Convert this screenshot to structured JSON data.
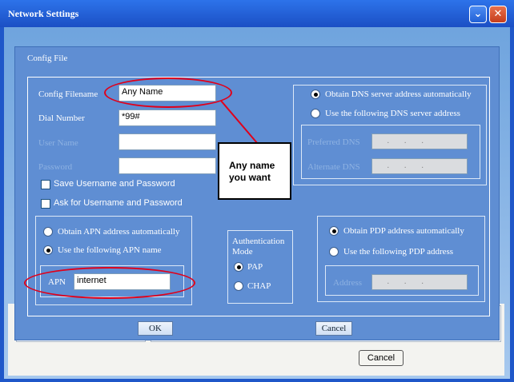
{
  "window": {
    "title": "Network Settings",
    "minimize_glyph": "⌄",
    "close_glyph": "✕"
  },
  "dialog": {
    "title": "Config File",
    "fields": {
      "config_filename": {
        "label": "Config Filename",
        "value": "Any Name"
      },
      "dial_number": {
        "label": "Dial Number",
        "value": "*99#"
      },
      "user_name": {
        "label": "User Name",
        "value": ""
      },
      "password": {
        "label": "Password",
        "value": ""
      }
    },
    "checkboxes": {
      "save_credentials": "Save Username and Password",
      "ask_credentials": "Ask for Username and Password"
    },
    "apn": {
      "auto": "Obtain APN address automatically",
      "manual": "Use the following APN name",
      "label": "APN",
      "value": "internet",
      "selected": "manual"
    },
    "authentication": {
      "heading": "Authentication Mode",
      "pap": "PAP",
      "chap": "CHAP",
      "selected": "pap"
    },
    "dns": {
      "auto": "Obtain DNS server address automatically",
      "manual": "Use the following DNS server address",
      "preferred": "Preferred DNS",
      "alternate": "Alternate DNS",
      "selected": "auto"
    },
    "pdp": {
      "auto": "Obtain PDP address automatically",
      "manual": "Use the following PDP address",
      "address": "Address",
      "selected": "auto"
    },
    "ok": "OK",
    "cancel": "Cancel"
  },
  "outer_cancel": "Cancel",
  "annotation": {
    "line1": "Any name",
    "line2": "you want",
    "color": "#e0001a"
  },
  "colors": {
    "title_bar": "#2d73ea",
    "dialog_bg": "#5f8ed3",
    "annotation_red": "#e0001a"
  }
}
